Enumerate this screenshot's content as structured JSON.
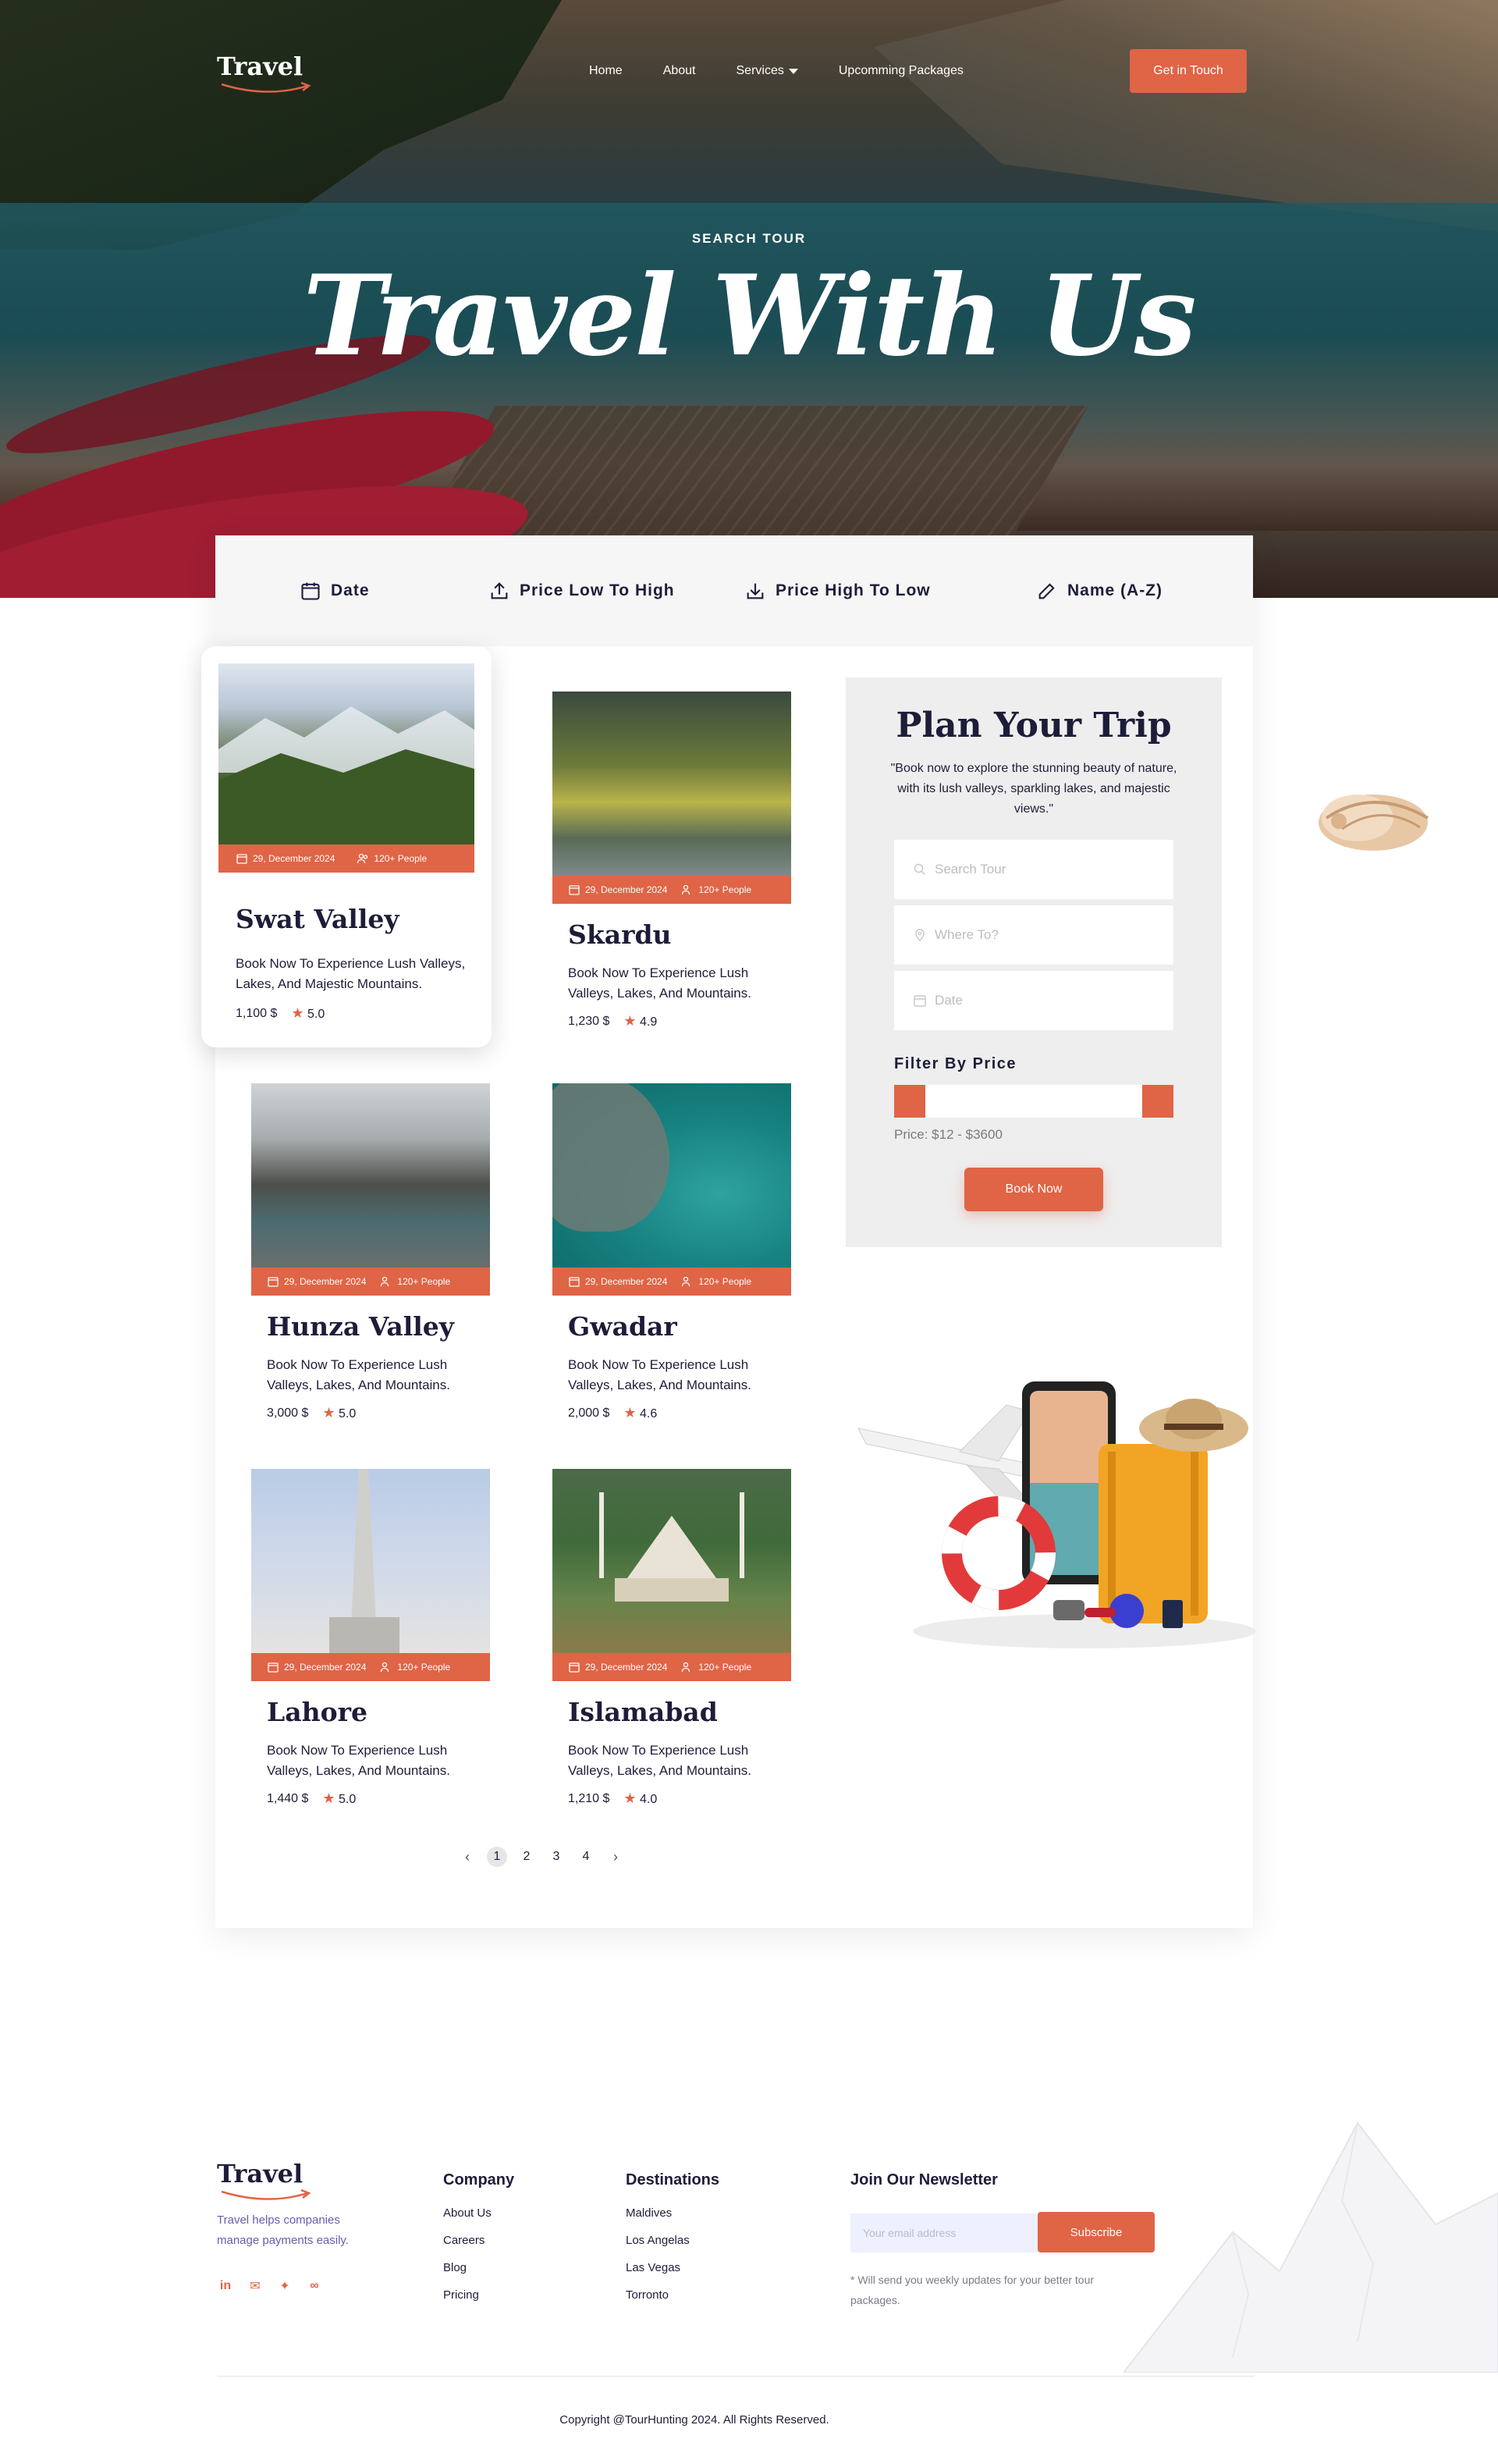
{
  "nav": {
    "logo": "Travel",
    "links": [
      "Home",
      "About",
      "Services",
      "Upcomming Packages"
    ],
    "cta": "Get in Touch"
  },
  "hero": {
    "kicker": "SEARCH TOUR",
    "title": "Travel With Us"
  },
  "sort": {
    "items": [
      {
        "label": "Date",
        "icon": "calendar-icon"
      },
      {
        "label": "Price Low To High",
        "icon": "upload-icon"
      },
      {
        "label": "Price High To Low",
        "icon": "download-icon"
      },
      {
        "label": "Name (A-Z)",
        "icon": "pencil-icon"
      }
    ]
  },
  "tours": [
    {
      "name": "Swat Valley",
      "date": "29, December 2024",
      "people": "120+ People",
      "desc": "Book Now To Experience Lush Valleys, Lakes, And Majestic Mountains.",
      "price": "1,100 $",
      "rating": "5.0"
    },
    {
      "name": "Skardu",
      "date": "29, December 2024",
      "people": "120+ People",
      "desc": "Book Now To  Experience Lush Valleys, Lakes, And Mountains.",
      "price": "1,230 $",
      "rating": "4.9"
    },
    {
      "name": "Hunza Valley",
      "date": "29, December 2024",
      "people": "120+ People",
      "desc": "Book Now To  Experience Lush Valleys, Lakes, And Mountains.",
      "price": "3,000 $",
      "rating": "5.0"
    },
    {
      "name": "Gwadar",
      "date": "29, December 2024",
      "people": "120+ People",
      "desc": "Book Now To  Experience Lush Valleys, Lakes, And Mountains.",
      "price": "2,000 $",
      "rating": "4.6"
    },
    {
      "name": "Lahore",
      "date": "29, December 2024",
      "people": "120+ People",
      "desc": "Book Now To  Experience Lush Valleys, Lakes, And Mountains.",
      "price": "1,440 $",
      "rating": "5.0"
    },
    {
      "name": "Islamabad",
      "date": "29, December 2024",
      "people": "120+ People",
      "desc": "Book Now To  Experience Lush Valleys, Lakes, And Mountains.",
      "price": "1,210 $",
      "rating": "4.0"
    }
  ],
  "plan": {
    "title": "Plan Your Trip",
    "text": "\"Book now to explore the stunning beauty of nature, with its lush valleys, sparkling lakes, and majestic views.\"",
    "search_placeholder": "Search Tour",
    "where_placeholder": "Where To?",
    "date_placeholder": "Date",
    "filter_label": "Filter By Price",
    "price_range": "Price: $12 - $3600",
    "book": "Book Now"
  },
  "pagination": {
    "pages": [
      "1",
      "2",
      "3",
      "4"
    ],
    "active": "1",
    "prev": "‹",
    "next": "›"
  },
  "footer": {
    "logo": "Travel",
    "tagline": "Travel helps companies manage payments easily.",
    "socials": [
      "linkedin-icon",
      "messenger-icon",
      "twitter-icon",
      "infinity-icon"
    ],
    "company": {
      "title": "Company",
      "links": [
        "About Us",
        "Careers",
        "Blog",
        "Pricing"
      ]
    },
    "destinations": {
      "title": "Destinations",
      "links": [
        "Maldives",
        "Los Angelas",
        "Las Vegas",
        "Torronto"
      ]
    },
    "newsletter": {
      "title": "Join Our Newsletter",
      "placeholder": "Your email address",
      "button": "Subscribe",
      "note": "* Will send you weekly updates for your better tour packages."
    },
    "copyright": "Copyright @TourHunting 2024. All Rights Reserved."
  },
  "colors": {
    "accent": "#e06446",
    "ink": "#1d1d3a",
    "panel_grey": "#eeeeee"
  }
}
